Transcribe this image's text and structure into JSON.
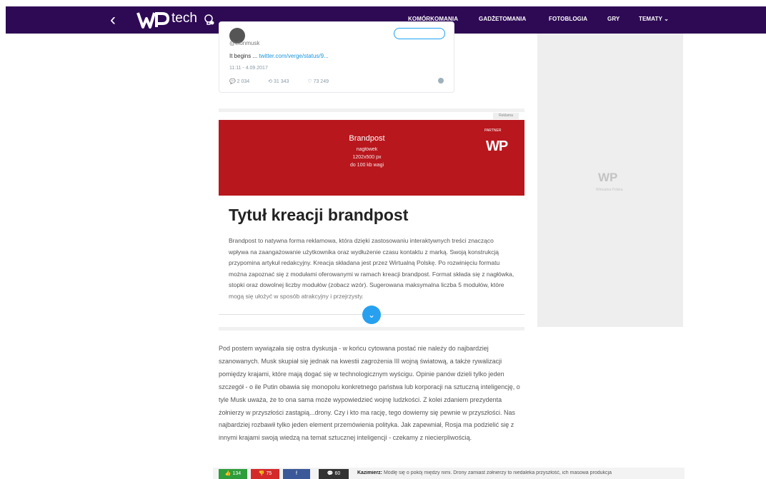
{
  "nav": {
    "back": "‹",
    "brand_wp": "WP",
    "brand_section": "tech",
    "items": [
      "KOMÓRKOMANIA",
      "GADŻETOMANIA",
      "FOTOBLOGIA",
      "GRY",
      "TEMATY"
    ]
  },
  "tweet": {
    "handle": "@elonmusk",
    "text": "It begins ...",
    "link": "twitter.com/verge/status/9...",
    "time": "11:11 - 4.09.2017",
    "replies": "2 034",
    "retweets": "31 343",
    "likes": "73 249"
  },
  "ad": {
    "label": "Reklama",
    "banner_title": "Brandpost",
    "banner_line1": "nagłówek",
    "banner_line2": "1202x500 px",
    "banner_line3": "do 100 kb wagi",
    "partner": "PARTNER",
    "partner_logo": "WP",
    "title": "Tytuł kreacji brandpost",
    "text": "Brandpost to natywna forma reklamowa, która dzięki zastosowaniu interaktywnych treści znacząco wpływa na zaangażowanie użytkownika oraz wydłużenie czasu kontaktu z marką. Swoją konstrukcją przypomina artykuł redakcyjny. Kreacja składana jest przez Wirtualną Polskę. Po rozwinięciu formatu można zapoznać się z modułami oferowanymi w ramach kreacji brandpost. Format składa się z nagłówka, stopki oraz dowolnej liczby modułów (zobacz wzór). Sugerowana maksymalna liczba 5 modułów, które mogą się ułożyć w sposób atrakcyjny i przejrzysty."
  },
  "sidebar": {
    "logo": "WP",
    "caption": "Wirtualna Polska"
  },
  "article": {
    "text": "Pod postem wywiązała się ostra dyskusja - w końcu cytowana postać nie należy do najbardziej szanowanych. Musk skupiał się jednak na kwestii zagrożenia III wojną światową, a także rywalizacji pomiędzy krajami, które mają dogać się w technologicznym wyścigu. Opinie panów dzieli tylko jeden szczegół - o ile Putin obawia się monopolu konkretnego państwa lub korporacji na sztuczną inteligencję, o tyle Musk uważa, że to ona sama może wypowiedzieć wojnę ludzkości. Z kolei zdaniem prezydenta żołnierzy w przyszłości zastąpią...drony. Czy i kto ma rację, tego dowiemy się pewnie w przyszłości. Nas najbardziej rozbawił tylko jeden element przemówienia polityka. Jak zapewniał, Rosja ma podzielić się z innymi krajami swoją wiedzą na temat sztucznej inteligencji - czekamy z niecierpliwością."
  },
  "bottom": {
    "likes": "134",
    "dislikes": "75",
    "facebook": "f",
    "comments": "60",
    "comment_author": "Kazimierz:",
    "comment_text": "Módlę się o pokój między nimi. Drony zamiast żołnierzy to niedaleka przyszłość, ich masowa produkcja"
  }
}
